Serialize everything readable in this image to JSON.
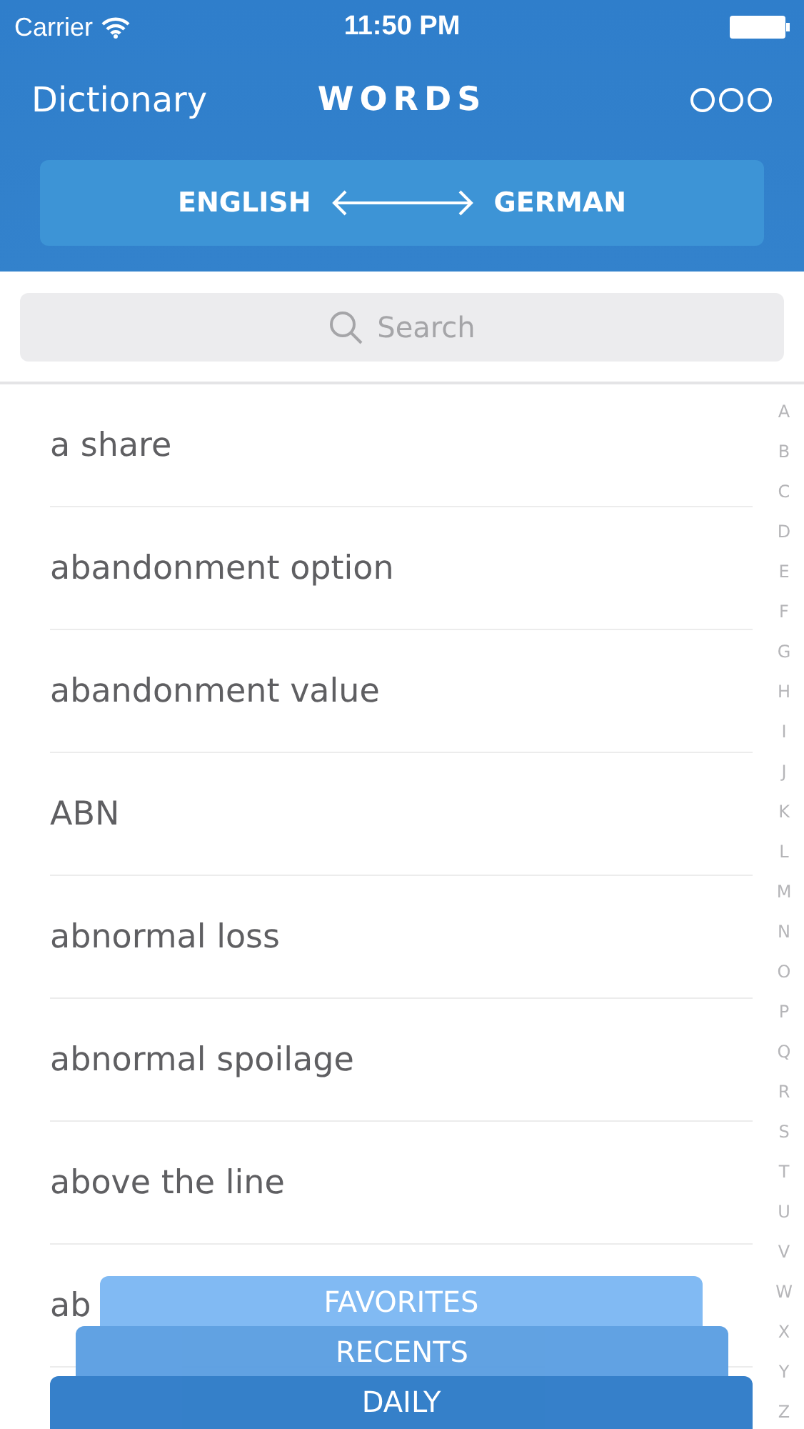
{
  "status_bar": {
    "carrier": "Carrier",
    "time": "11:50 PM"
  },
  "nav": {
    "back": "Dictionary",
    "title": "WORDS"
  },
  "languages": {
    "from": "ENGLISH",
    "to": "GERMAN"
  },
  "search": {
    "placeholder": "Search"
  },
  "words": [
    "a share",
    "abandonment option",
    "abandonment value",
    "ABN",
    "abnormal loss",
    "abnormal spoilage",
    "above the line",
    "ab"
  ],
  "index": [
    "A",
    "B",
    "C",
    "D",
    "E",
    "F",
    "G",
    "H",
    "I",
    "J",
    "K",
    "L",
    "M",
    "N",
    "O",
    "P",
    "Q",
    "R",
    "S",
    "T",
    "U",
    "V",
    "W",
    "X",
    "Y",
    "Z"
  ],
  "drawers": [
    {
      "label": "FAVORITES",
      "color": "#7db8f3"
    },
    {
      "label": "RECENTS",
      "color": "#5c9fe2"
    },
    {
      "label": "DAILY",
      "color": "#2f7cc8"
    }
  ]
}
